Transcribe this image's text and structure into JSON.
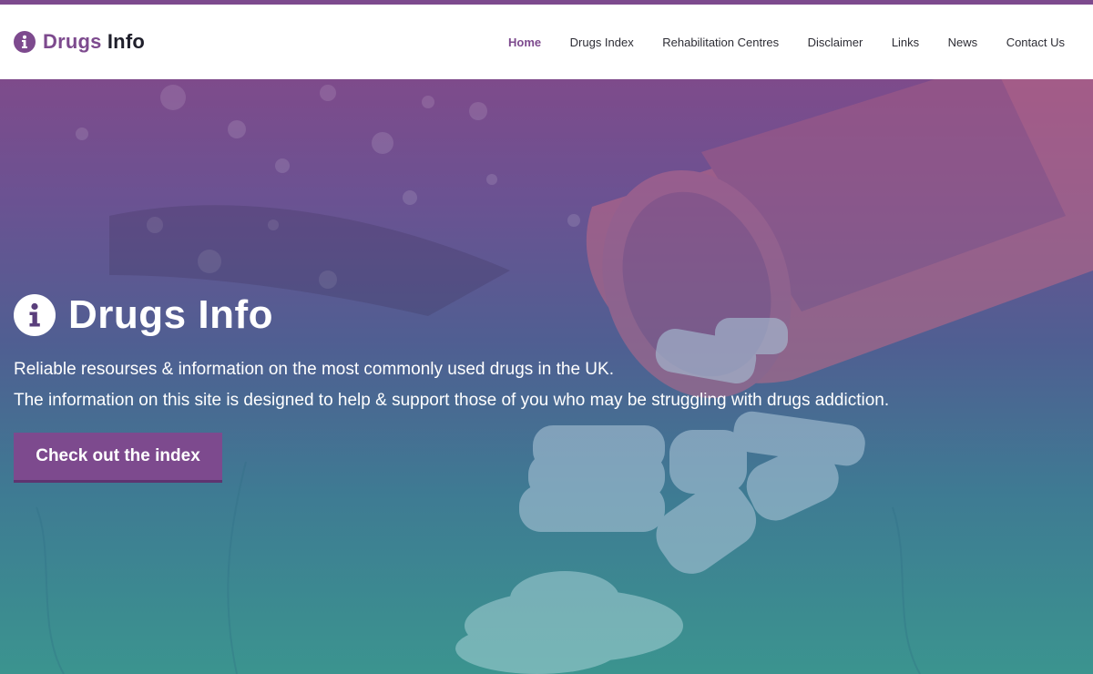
{
  "brand": {
    "name_accent": "Drugs",
    "name_rest": "Info",
    "icon": "info-circle-icon",
    "color": "#7d4a8e"
  },
  "nav": {
    "items": [
      {
        "label": "Home",
        "active": true
      },
      {
        "label": "Drugs Index",
        "active": false
      },
      {
        "label": "Rehabilitation Centres",
        "active": false
      },
      {
        "label": "Disclaimer",
        "active": false
      },
      {
        "label": "Links",
        "active": false
      },
      {
        "label": "News",
        "active": false
      },
      {
        "label": "Contact Us",
        "active": false
      }
    ]
  },
  "hero": {
    "icon": "info-circle-icon",
    "title": "Drugs Info",
    "line1": "Reliable resourses & information on the most commonly used drugs in the UK.",
    "line2": "The information on this site is designed to help & support those of you who may be struggling with drugs addiction.",
    "cta_label": "Check out the index",
    "background": "pills-photo-overlay"
  }
}
